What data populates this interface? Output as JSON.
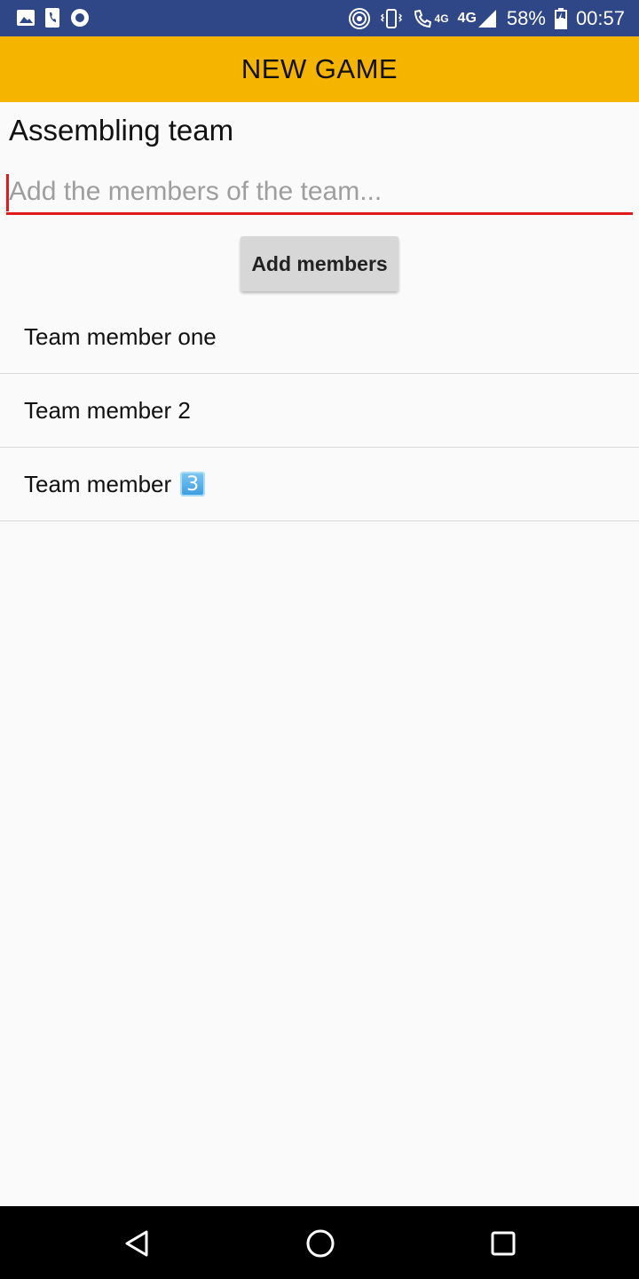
{
  "status_bar": {
    "battery": "58%",
    "time": "00:57",
    "network": "4G",
    "call_network": "4G",
    "icons_left": [
      "image-icon",
      "phone-app-icon",
      "record-icon"
    ],
    "icons_right": [
      "hotspot-icon",
      "vibrate-icon",
      "wifi-call-icon",
      "signal-icon",
      "battery-icon"
    ]
  },
  "app_bar": {
    "title": "NEW GAME",
    "color": "#f5b400"
  },
  "main": {
    "section_title": "Assembling team",
    "input": {
      "value": "",
      "placeholder": "Add the members of the team..."
    },
    "add_button_label": "Add members",
    "members": [
      {
        "name": "Team member one"
      },
      {
        "name": "Team member 2"
      },
      {
        "name": "Team member",
        "emoji": "3"
      }
    ]
  },
  "nav_bar": {
    "icons": [
      "back-icon",
      "home-icon",
      "recents-icon"
    ]
  },
  "colors": {
    "status_bar": "#2f4786",
    "accent": "#e01b1b",
    "button": "#d7d7d7"
  }
}
